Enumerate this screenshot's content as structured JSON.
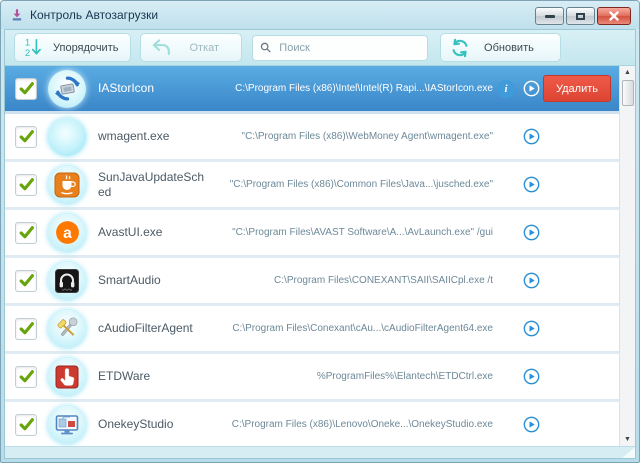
{
  "window": {
    "title": "Контроль Автозагрузки"
  },
  "toolbar": {
    "sort_label": "Упорядочить",
    "undo_label": "Откат",
    "search_placeholder": "Поиск",
    "search_value": "",
    "refresh_label": "Обновить"
  },
  "list": {
    "delete_label": "Удалить",
    "items": [
      {
        "name": "IAStorIcon",
        "path": "C:\\Program Files (x86)\\Intel\\Intel(R) Rapi...\\IAStorIcon.exe",
        "icon": "intel-rapid-storage-icon",
        "checked": true,
        "selected": true
      },
      {
        "name": "wmagent.exe",
        "path": "\"C:\\Program Files (x86)\\WebMoney Agent\\wmagent.exe\"",
        "icon": "webmoney-sphere-icon",
        "checked": true,
        "selected": false
      },
      {
        "name": "SunJavaUpdateSched",
        "path": "\"C:\\Program Files (x86)\\Common Files\\Java...\\jusched.exe\"",
        "icon": "java-coffee-icon",
        "checked": true,
        "selected": false
      },
      {
        "name": "AvastUI.exe",
        "path": "\"C:\\Program Files\\AVAST Software\\A...\\AvLaunch.exe\" /gui",
        "icon": "avast-icon",
        "checked": true,
        "selected": false
      },
      {
        "name": "SmartAudio",
        "path": "C:\\Program Files\\CONEXANT\\SAII\\SAIICpl.exe /t",
        "icon": "headphones-icon",
        "checked": true,
        "selected": false
      },
      {
        "name": "cAudioFilterAgent",
        "path": "C:\\Program Files\\Conexant\\cAu...\\cAudioFilterAgent64.exe",
        "icon": "tools-icon",
        "checked": true,
        "selected": false
      },
      {
        "name": "ETDWare",
        "path": "%ProgramFiles%\\Elantech\\ETDCtrl.exe",
        "icon": "touchpad-hand-icon",
        "checked": true,
        "selected": false
      },
      {
        "name": "OnekeyStudio",
        "path": "C:\\Program Files (x86)\\Lenovo\\Oneke...\\OnekeyStudio.exe",
        "icon": "monitor-icon",
        "checked": true,
        "selected": false
      }
    ]
  },
  "colors": {
    "selected_row_top": "#5aace3",
    "selected_row_bottom": "#3a86c8",
    "delete_button_red": "#dd4433",
    "accent_teal": "#35c2bf",
    "check_green": "#67a50b",
    "info_blue": "#3f9bd9",
    "toolbar_bg": "#cdeaf1"
  }
}
